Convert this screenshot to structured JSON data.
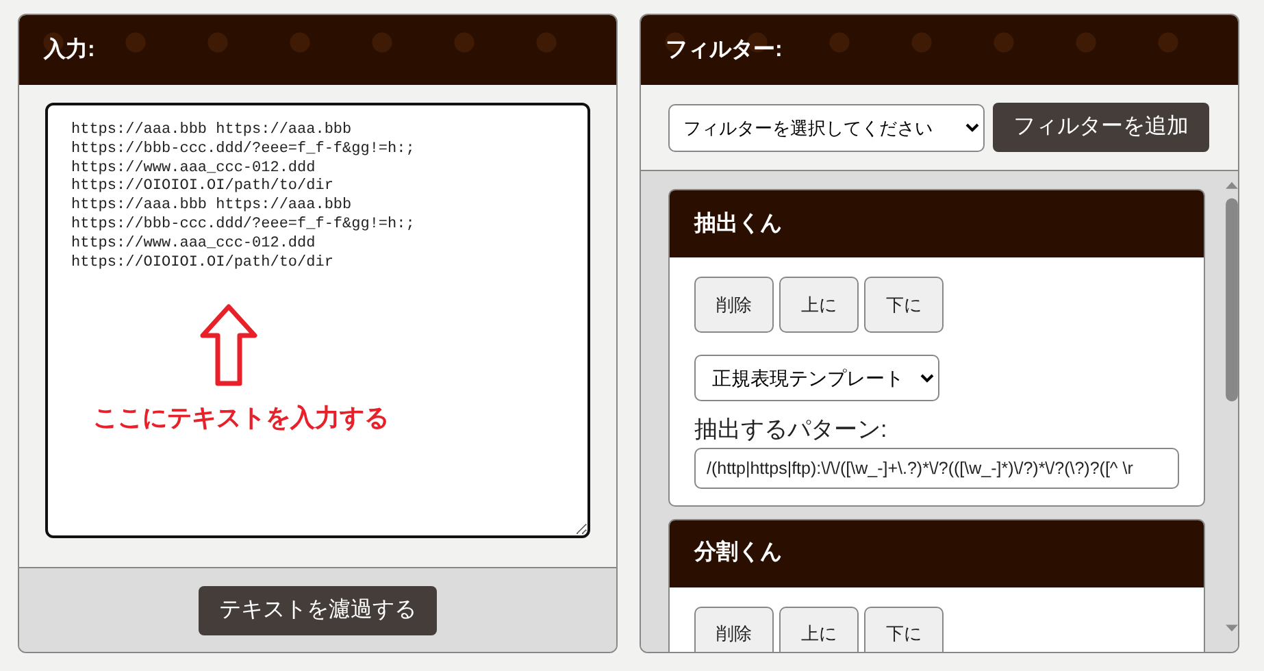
{
  "input_panel": {
    "title": "入力:",
    "textarea": {
      "value": "https://aaa.bbb https://aaa.bbb\nhttps://bbb-ccc.ddd/?eee=f_f-f&gg!=h:;\nhttps://www.aaa_ccc-012.ddd\nhttps://OIOIOI.OI/path/to/dir\nhttps://aaa.bbb https://aaa.bbb\nhttps://bbb-ccc.ddd/?eee=f_f-f&gg!=h:;\nhttps://www.aaa_ccc-012.ddd\nhttps://OIOIOI.OI/path/to/dir"
    },
    "annotation": {
      "text": "ここにテキストを入力する"
    },
    "submit_button": "テキストを濾過する"
  },
  "filter_panel": {
    "title": "フィルター:",
    "filter_select": {
      "value": "フィルターを選択してください"
    },
    "add_button": "フィルターを追加",
    "filters": [
      {
        "kind": "extract",
        "title": "抽出くん",
        "buttons": [
          "削除",
          "上に",
          "下に"
        ],
        "template_select": "正規表現テンプレート",
        "pattern_label": "抽出するパターン:",
        "pattern_value": "/(http|https|ftp):\\/\\/([\\w_-]+\\.?)*\\/?(([\\w_-]*)\\/?)*\\/?(\\?)?([^ \\r"
      },
      {
        "kind": "split",
        "title": "分割くん",
        "buttons": [
          "削除",
          "上に",
          "下に"
        ]
      }
    ]
  }
}
